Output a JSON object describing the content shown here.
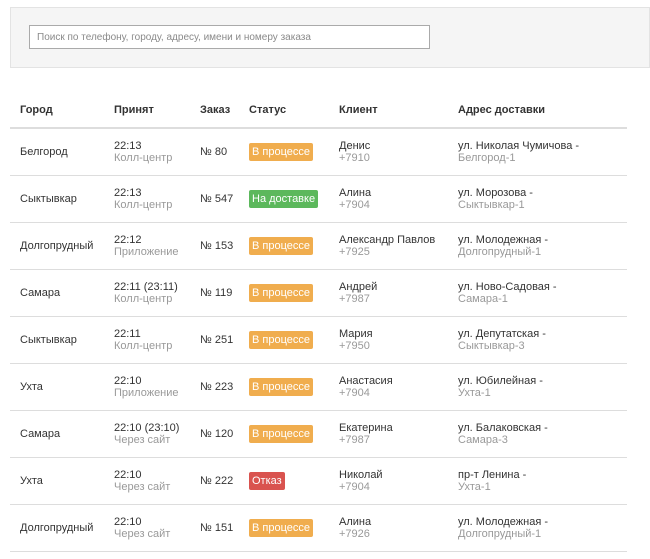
{
  "search": {
    "placeholder": "Поиск по телефону, городу, адресу, имени и номеру заказа"
  },
  "table": {
    "headers": {
      "city": "Город",
      "accepted": "Принят",
      "order": "Заказ",
      "status": "Статус",
      "client": "Клиент",
      "address": "Адрес доставки"
    },
    "rows": [
      {
        "city": "Белгород",
        "time": "22:13",
        "source": "Колл-центр",
        "order": "№ 80",
        "status": "В процессе",
        "status_kind": "progress",
        "client_name": "Денис",
        "client_phone": "+7910",
        "street": "ул. Николая Чумичова -",
        "locality": "Белгород-1"
      },
      {
        "city": "Сыктывкар",
        "time": "22:13",
        "source": "Колл-центр",
        "order": "№ 547",
        "status": "На доставке",
        "status_kind": "delivery",
        "client_name": "Алина",
        "client_phone": "+7904",
        "street": "ул. Морозова -",
        "locality": "Сыктывкар-1"
      },
      {
        "city": "Долгопрудный",
        "time": "22:12",
        "source": "Приложение",
        "order": "№ 153",
        "status": "В процессе",
        "status_kind": "progress",
        "client_name": "Александр Павлов",
        "client_phone": "+7925",
        "street": "ул. Молодежная -",
        "locality": "Долгопрудный-1"
      },
      {
        "city": "Самара",
        "time": "22:11 (23:11)",
        "source": "Колл-центр",
        "order": "№ 119",
        "status": "В процессе",
        "status_kind": "progress",
        "client_name": "Андрей",
        "client_phone": "+7987",
        "street": "ул. Ново-Садовая -",
        "locality": "Самара-1"
      },
      {
        "city": "Сыктывкар",
        "time": "22:11",
        "source": "Колл-центр",
        "order": "№ 251",
        "status": "В процессе",
        "status_kind": "progress",
        "client_name": "Мария",
        "client_phone": "+7950",
        "street": "ул. Депутатская -",
        "locality": "Сыктывкар-3"
      },
      {
        "city": "Ухта",
        "time": "22:10",
        "source": "Приложение",
        "order": "№ 223",
        "status": "В процессе",
        "status_kind": "progress",
        "client_name": "Анастасия",
        "client_phone": "+7904",
        "street": "ул. Юбилейная -",
        "locality": "Ухта-1"
      },
      {
        "city": "Самара",
        "time": "22:10 (23:10)",
        "source": "Через сайт",
        "order": "№ 120",
        "status": "В процессе",
        "status_kind": "progress",
        "client_name": "Екатерина",
        "client_phone": "+7987",
        "street": "ул. Балаковская -",
        "locality": "Самара-3"
      },
      {
        "city": "Ухта",
        "time": "22:10",
        "source": "Через сайт",
        "order": "№ 222",
        "status": "Отказ",
        "status_kind": "refused",
        "client_name": "Николай",
        "client_phone": "+7904",
        "street": "пр-т Ленина -",
        "locality": "Ухта-1"
      },
      {
        "city": "Долгопрудный",
        "time": "22:10",
        "source": "Через сайт",
        "order": "№ 151",
        "status": "В процессе",
        "status_kind": "progress",
        "client_name": "Алина",
        "client_phone": "+7926",
        "street": "ул. Молодежная -",
        "locality": "Долгопрудный-1"
      }
    ]
  },
  "colors": {
    "status_progress": "#f0ad4e",
    "status_delivery": "#5cb85c",
    "status_refused": "#d9534f",
    "secondary_text": "#999999"
  }
}
